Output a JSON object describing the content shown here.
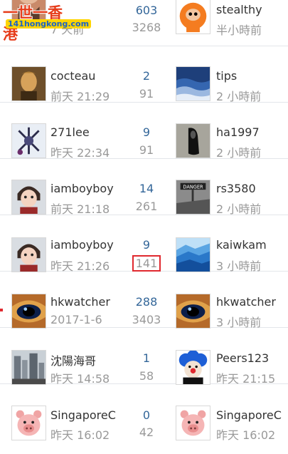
{
  "watermark": {
    "title": "一世一香港",
    "url": "141hongkong.com"
  },
  "threads": [
    {
      "author": "",
      "date": "7 天前",
      "replies": "603",
      "views": "3268",
      "last_poster": "stealthy",
      "last_time": "半小時前",
      "avatar_icon": "partial-avatar-icon",
      "last_avatar_icon": "kenny-cartoon-avatar-icon"
    },
    {
      "author": "cocteau",
      "date": "前天 21:29",
      "replies": "2",
      "views": "91",
      "last_poster": "tips",
      "last_time": "2 小時前",
      "avatar_icon": "gold-face-avatar-icon",
      "last_avatar_icon": "blue-water-avatar-icon"
    },
    {
      "author": "271lee",
      "date": "昨天 22:34",
      "replies": "9",
      "views": "91",
      "last_poster": "ha1997",
      "last_time": "2 小時前",
      "avatar_icon": "mech-figure-avatar-icon",
      "last_avatar_icon": "black-shoe-avatar-icon"
    },
    {
      "author": "iamboyboy",
      "date": "前天 21:18",
      "replies": "14",
      "views": "261",
      "last_poster": "rs3580",
      "last_time": "2 小時前",
      "avatar_icon": "anime-boy-avatar-icon",
      "last_avatar_icon": "danger-sign-avatar-icon"
    },
    {
      "author": "iamboyboy",
      "date": "昨天 21:26",
      "replies": "9",
      "views": "141",
      "views_highlighted": true,
      "last_poster": "kaiwkam",
      "last_time": "3 小時前",
      "avatar_icon": "anime-boy-avatar-icon",
      "last_avatar_icon": "blue-mountains-avatar-icon"
    },
    {
      "author": "hkwatcher",
      "date": "2017-1-6",
      "replies": "288",
      "views": "3403",
      "last_poster": "hkwatcher",
      "last_time": "3 小時前",
      "avatar_icon": "eye-avatar-icon",
      "last_avatar_icon": "eye-avatar-icon"
    },
    {
      "author": "沈陽海哥",
      "date": "昨天 14:58",
      "replies": "1",
      "views": "58",
      "last_poster": "Peers123",
      "last_time": "昨天 21:15",
      "avatar_icon": "city-street-avatar-icon",
      "last_avatar_icon": "clown-avatar-icon"
    },
    {
      "author": "SingaporeC",
      "date": "昨天 16:02",
      "replies": "0",
      "views": "42",
      "last_poster": "SingaporeC",
      "last_time": "昨天 16:02",
      "avatar_icon": "pink-pig-avatar-icon",
      "last_avatar_icon": "pink-pig-avatar-icon"
    }
  ],
  "colors": {
    "link": "#333333",
    "muted": "#999999",
    "count": "#336699",
    "highlight": "#e0292f",
    "watermark_red": "#e63c1a",
    "watermark_yellow": "#ffd500"
  }
}
